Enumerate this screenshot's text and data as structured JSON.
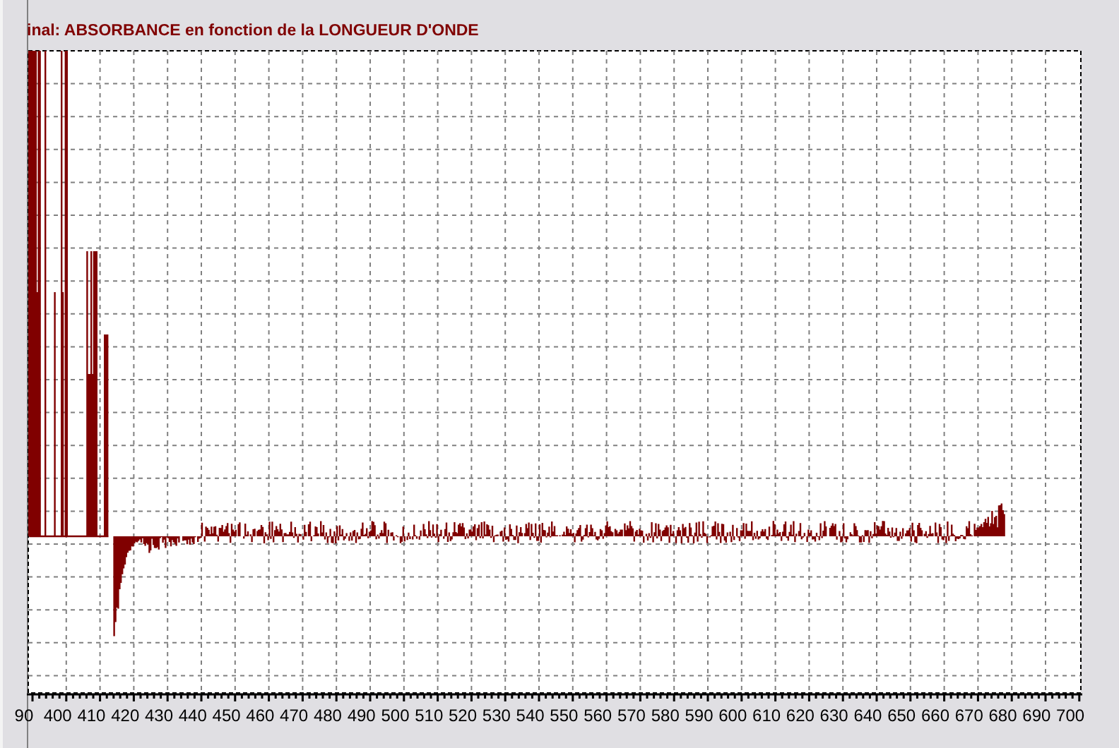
{
  "chart": {
    "title": "inal: ABSORBANCE en fonction de la LONGUEUR D'ONDE",
    "x_tick_labels": [
      "90",
      "400",
      "410",
      "420",
      "430",
      "440",
      "450",
      "460",
      "470",
      "480",
      "490",
      "500",
      "510",
      "520",
      "530",
      "540",
      "550",
      "560",
      "570",
      "580",
      "590",
      "600",
      "610",
      "620",
      "630",
      "640",
      "650",
      "660",
      "670",
      "680",
      "690",
      "700"
    ]
  }
}
